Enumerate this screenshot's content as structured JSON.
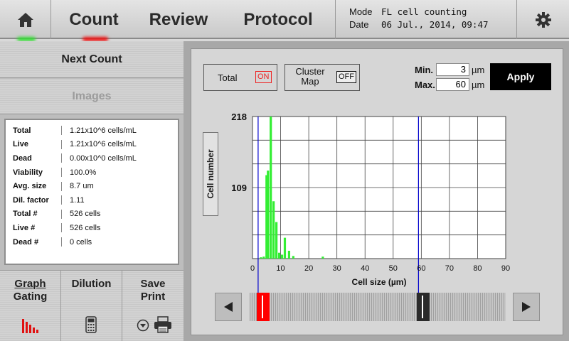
{
  "header": {
    "tabs": [
      "Count",
      "Review",
      "Protocol"
    ],
    "mode_label": "Mode",
    "mode_value": "FL cell counting",
    "date_label": "Date",
    "date_value": "06 Jul., 2014, 09:47",
    "icons": {
      "home": "home-icon",
      "settings": "gear-icon"
    }
  },
  "left": {
    "next_count": "Next Count",
    "images": "Images",
    "stats": [
      {
        "label": "Total",
        "value": "1.21x10^6 cells/mL"
      },
      {
        "label": "Live",
        "value": "1.21x10^6 cells/mL"
      },
      {
        "label": "Dead",
        "value": "0.00x10^0 cells/mL"
      },
      {
        "label": "Viability",
        "value": "100.0%"
      },
      {
        "label": "Avg. size",
        "value": "8.7 um"
      },
      {
        "label": "Dil. factor",
        "value": "1.11"
      },
      {
        "label": "Total #",
        "value": "526 cells"
      },
      {
        "label": "Live #",
        "value": "526 cells"
      },
      {
        "label": "Dead #",
        "value": "0 cells"
      }
    ],
    "tools": {
      "graph_line1": "Graph",
      "graph_line2": "Gating",
      "dilution": "Dilution",
      "save_line1": "Save",
      "save_line2": "Print"
    }
  },
  "controls": {
    "total_label": "Total",
    "total_state": "ON",
    "cluster_label_1": "Cluster",
    "cluster_label_2": "Map",
    "cluster_state": "OFF",
    "min_label": "Min.",
    "min_value": "3",
    "max_label": "Max.",
    "max_value": "60",
    "unit": "µm",
    "apply": "Apply"
  },
  "chart_data": {
    "type": "bar",
    "xlabel": "Cell size (µm)",
    "ylabel": "Cell number",
    "xlim": [
      0,
      90
    ],
    "ylim": [
      0,
      218
    ],
    "x_ticks": [
      0,
      10,
      20,
      30,
      40,
      50,
      60,
      70,
      80,
      90
    ],
    "y_ticks": [
      109,
      218
    ],
    "gate_min": 2,
    "gate_max": 59,
    "bars": [
      {
        "x": 3,
        "y": 2
      },
      {
        "x": 4,
        "y": 3
      },
      {
        "x": 5,
        "y": 128
      },
      {
        "x": 5.5,
        "y": 135
      },
      {
        "x": 6.5,
        "y": 218
      },
      {
        "x": 7.5,
        "y": 88
      },
      {
        "x": 8.5,
        "y": 56
      },
      {
        "x": 9.5,
        "y": 9
      },
      {
        "x": 10.5,
        "y": 6
      },
      {
        "x": 11.5,
        "y": 32
      },
      {
        "x": 13,
        "y": 12
      },
      {
        "x": 14.5,
        "y": 4
      },
      {
        "x": 25,
        "y": 3
      }
    ],
    "colors": {
      "bar": "#33ee33",
      "gate": "#0000cc"
    }
  },
  "slider": {
    "left_handle_color": "#ff0000",
    "right_handle_color": "#2a2a2a"
  }
}
